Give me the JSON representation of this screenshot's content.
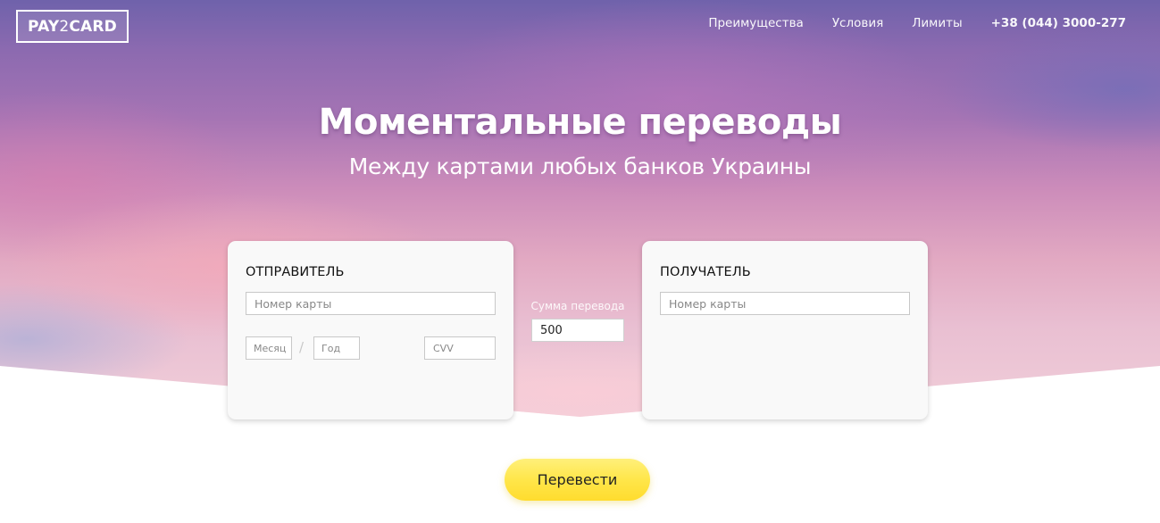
{
  "header": {
    "logo": {
      "part1": "PAY",
      "part2": "2",
      "part3": "CARD"
    },
    "nav": [
      {
        "label": "Преимущества"
      },
      {
        "label": "Условия"
      },
      {
        "label": "Лимиты"
      }
    ],
    "phone": "+38 (044) 3000-277"
  },
  "hero": {
    "title": "Моментальные переводы",
    "subtitle": "Между картами любых банков Украины"
  },
  "sender": {
    "title": "ОТПРАВИТЕЛЬ",
    "card_number_placeholder": "Номер карты",
    "month_placeholder": "Месяц",
    "separator": "/",
    "year_placeholder": "Год",
    "cvv_placeholder": "CVV"
  },
  "amount": {
    "label": "Сумма перевода",
    "value": "500"
  },
  "receiver": {
    "title": "ПОЛУЧАТЕЛЬ",
    "card_number_placeholder": "Номер карты"
  },
  "actions": {
    "submit_label": "Перевести"
  },
  "colors": {
    "button_yellow": "#ffe64a",
    "hero_purple": "#8c6ab0",
    "hero_pink": "#e2a9c2",
    "card_bg": "#f9f9f9"
  }
}
